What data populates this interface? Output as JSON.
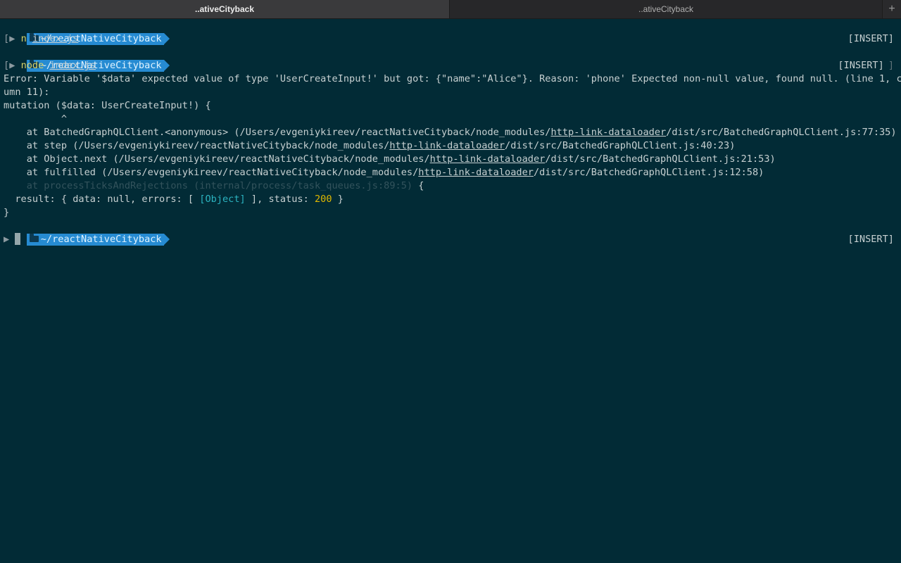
{
  "tabs": [
    {
      "label": "..ativeCityback",
      "active": true
    },
    {
      "label": "..ativeCityback",
      "active": false
    }
  ],
  "add_tab": "+",
  "prompt": {
    "dir": "~/reactNativeCityback",
    "glyph": "▶",
    "open_bracket": "[",
    "close_bracket": "]"
  },
  "mode": "[INSERT]",
  "commands": [
    {
      "prog": "n",
      "arg": "index.js"
    },
    {
      "prog": "node",
      "arg": "index.js"
    }
  ],
  "error": {
    "line1": "Error: Variable '$data' expected value of type 'UserCreateInput!' but got: {\"name\":\"Alice\"}. Reason: 'phone' Expected non-null value, found null. (line 1, col",
    "line2": "umn 11):",
    "mutation": "mutation ($data: UserCreateInput!) {",
    "caret": "          ^"
  },
  "stack": [
    {
      "pre": "    at BatchedGraphQLClient.<anonymous> (/Users/evgeniykireev/reactNativeCityback/node_modules/",
      "link": "http-link-dataloader",
      "post": "/dist/src/BatchedGraphQLClient.js:77:35)"
    },
    {
      "pre": "    at step (/Users/evgeniykireev/reactNativeCityback/node_modules/",
      "link": "http-link-dataloader",
      "post": "/dist/src/BatchedGraphQLClient.js:40:23)"
    },
    {
      "pre": "    at Object.next (/Users/evgeniykireev/reactNativeCityback/node_modules/",
      "link": "http-link-dataloader",
      "post": "/dist/src/BatchedGraphQLClient.js:21:53)"
    },
    {
      "pre": "    at fulfilled (/Users/evgeniykireev/reactNativeCityback/node_modules/",
      "link": "http-link-dataloader",
      "post": "/dist/src/BatchedGraphQLClient.js:12:58)"
    }
  ],
  "stack_dim": "    at processTicksAndRejections (internal/process/task_queues.js:89:5)",
  "stack_dim_tail": " {",
  "result": {
    "pre": "  result: { data: null, errors: [ ",
    "obj": "[Object]",
    "mid": " ], status: ",
    "status": "200",
    "post": " }"
  },
  "close_brace": "}",
  "colors": {
    "background": "#022b36",
    "prompt_segment": "#268bd2",
    "command": "#d8d36a",
    "object": "#2bb3c0",
    "number": "#e0b800"
  }
}
